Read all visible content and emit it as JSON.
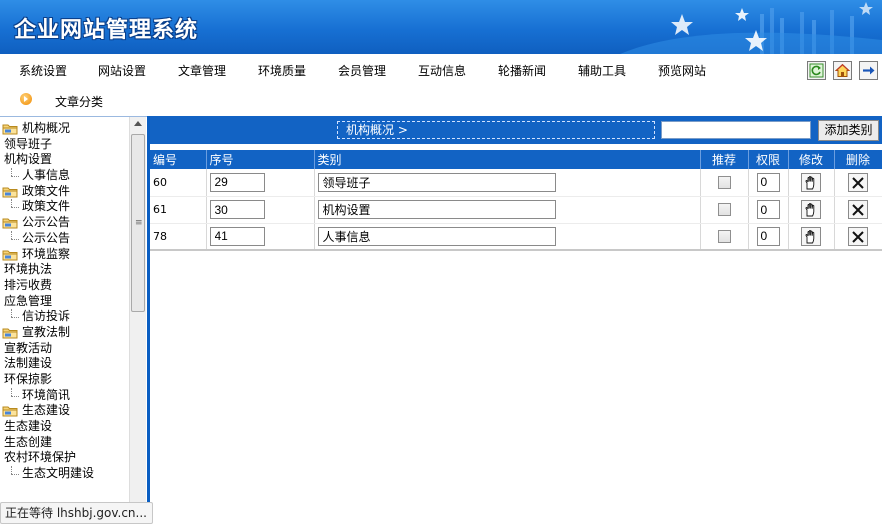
{
  "header": {
    "title": "企业网站管理系统"
  },
  "nav": {
    "items": [
      "系统设置",
      "网站设置",
      "文章管理",
      "环境质量",
      "会员管理",
      "互动信息",
      "轮播新闻",
      "辅助工具",
      "预览网站"
    ],
    "tools": [
      "refresh-icon",
      "home-icon",
      "logout-arrow-icon"
    ]
  },
  "subnav": {
    "label": "文章分类"
  },
  "tree": [
    {
      "type": "folder",
      "label": "机构概况"
    },
    {
      "type": "leaf",
      "label": "领导班子"
    },
    {
      "type": "leaf",
      "label": "机构设置"
    },
    {
      "type": "sub",
      "label": "人事信息"
    },
    {
      "type": "folder",
      "label": "政策文件"
    },
    {
      "type": "sub",
      "label": "政策文件"
    },
    {
      "type": "folder",
      "label": "公示公告"
    },
    {
      "type": "sub",
      "label": "公示公告"
    },
    {
      "type": "folder",
      "label": "环境监察"
    },
    {
      "type": "leaf",
      "label": "环境执法"
    },
    {
      "type": "leaf",
      "label": "排污收费"
    },
    {
      "type": "leaf",
      "label": "应急管理"
    },
    {
      "type": "sub",
      "label": "信访投诉"
    },
    {
      "type": "folder",
      "label": "宣教法制"
    },
    {
      "type": "leaf",
      "label": "宣教活动"
    },
    {
      "type": "leaf",
      "label": "法制建设"
    },
    {
      "type": "leaf",
      "label": "环保掠影"
    },
    {
      "type": "sub",
      "label": "环境简讯"
    },
    {
      "type": "folder",
      "label": "生态建设"
    },
    {
      "type": "leaf",
      "label": "生态建设"
    },
    {
      "type": "leaf",
      "label": "生态创建"
    },
    {
      "type": "leaf",
      "label": "农村环境保护"
    },
    {
      "type": "sub",
      "label": "生态文明建设"
    }
  ],
  "status": {
    "text": "正在等待 lhshbj.gov.cn..."
  },
  "main": {
    "breadcrumb": "机构概况 >",
    "search_value": "",
    "add_button": "添加类别",
    "columns": [
      "编号",
      "序号",
      "类别",
      "推荐",
      "权限",
      "修改",
      "删除"
    ],
    "rows": [
      {
        "id": "60",
        "order": "29",
        "category": "领导班子",
        "recommend": false,
        "permission": "0"
      },
      {
        "id": "61",
        "order": "30",
        "category": "机构设置",
        "recommend": false,
        "permission": "0"
      },
      {
        "id": "78",
        "order": "41",
        "category": "人事信息",
        "recommend": false,
        "permission": "0"
      }
    ]
  },
  "colors": {
    "primary_blue": "#1263c4",
    "banner_blue": "#1770d3",
    "accent_orange": "#f08a00"
  }
}
